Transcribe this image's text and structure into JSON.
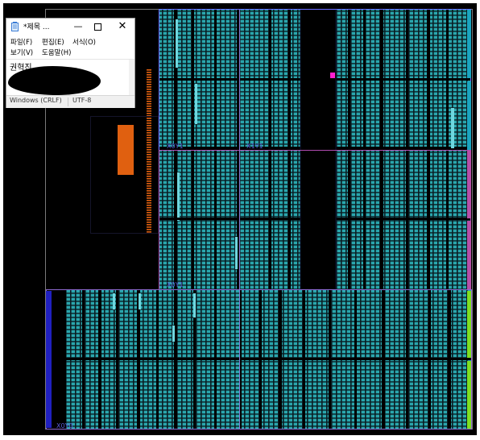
{
  "window": {
    "title": "*제목 ...",
    "close_glyph": "✕",
    "minimize_glyph": "—"
  },
  "menus": [
    "파일(F)",
    "편집(E)",
    "서식(O)",
    "보기(V)",
    "도움말(H)"
  ],
  "editor": {
    "text": "권혁진"
  },
  "statusbar": {
    "line_ending": "Windows (CRLF)",
    "encoding": "UTF-8"
  },
  "device_view": {
    "clock_region_labels": [
      "X0Y1",
      "X1Y1",
      "X0Y1",
      "X0Y0"
    ],
    "colors": {
      "background": "#000000",
      "logic": "#2aa6ad",
      "region_border_top": "#6c6cff",
      "region_border_mid": "#b04bb0",
      "lower_region_border": "#8e6ad0",
      "io_strip_cyan": "#1aa5c0",
      "io_strip_magenta": "#b84fa8",
      "io_strip_green": "#7fe020",
      "io_strip_blue": "#2020c0",
      "pblock_orange": "#e06010",
      "marker_magenta": "#ff20d0"
    }
  }
}
